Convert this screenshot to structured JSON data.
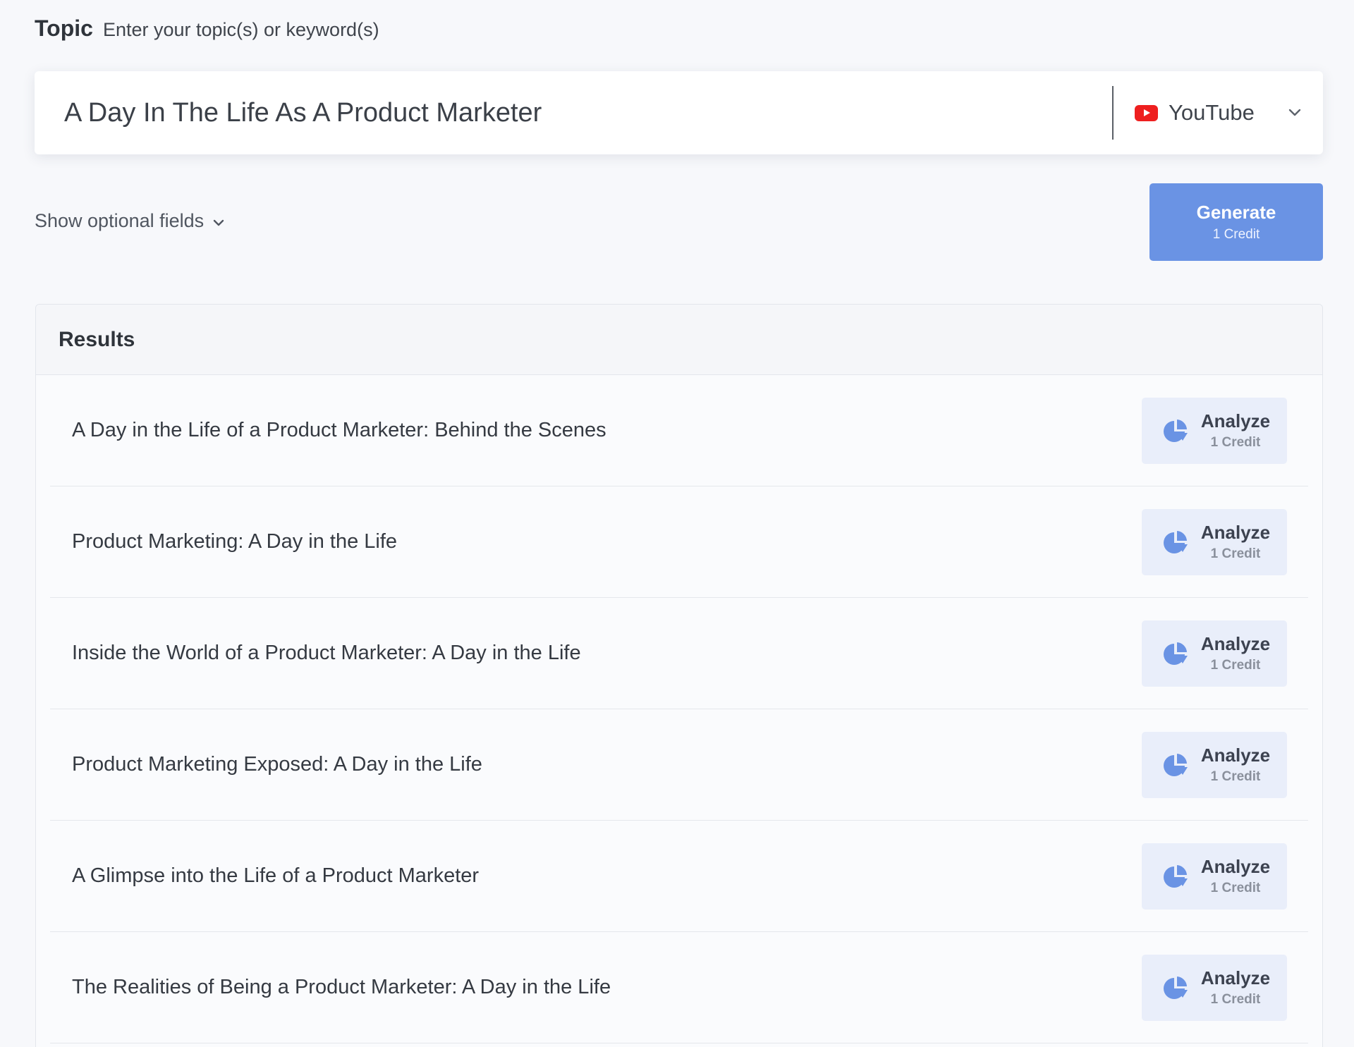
{
  "topic": {
    "title": "Topic",
    "hint": "Enter your topic(s) or keyword(s)",
    "value": "A Day In The Life As A Product Marketer"
  },
  "platform": {
    "selected": "YouTube",
    "icon": "youtube-icon",
    "dropdown_icon": "chevron-down-icon"
  },
  "optional_fields": {
    "label": "Show optional fields",
    "icon": "chevron-down-icon"
  },
  "generate": {
    "label": "Generate",
    "credit": "1 Credit",
    "color": "#6a93e4"
  },
  "results": {
    "title": "Results",
    "items": [
      {
        "title": "A Day in the Life of a Product Marketer: Behind the Scenes",
        "action": "Analyze",
        "credit": "1 Credit"
      },
      {
        "title": "Product Marketing: A Day in the Life",
        "action": "Analyze",
        "credit": "1 Credit"
      },
      {
        "title": "Inside the World of a Product Marketer: A Day in the Life",
        "action": "Analyze",
        "credit": "1 Credit"
      },
      {
        "title": "Product Marketing Exposed: A Day in the Life",
        "action": "Analyze",
        "credit": "1 Credit"
      },
      {
        "title": "A Glimpse into the Life of a Product Marketer",
        "action": "Analyze",
        "credit": "1 Credit"
      },
      {
        "title": "The Realities of Being a Product Marketer: A Day in the Life",
        "action": "Analyze",
        "credit": "1 Credit"
      }
    ],
    "action_icon": "pie-chart-icon",
    "action_icon_color": "#6a93e4"
  }
}
